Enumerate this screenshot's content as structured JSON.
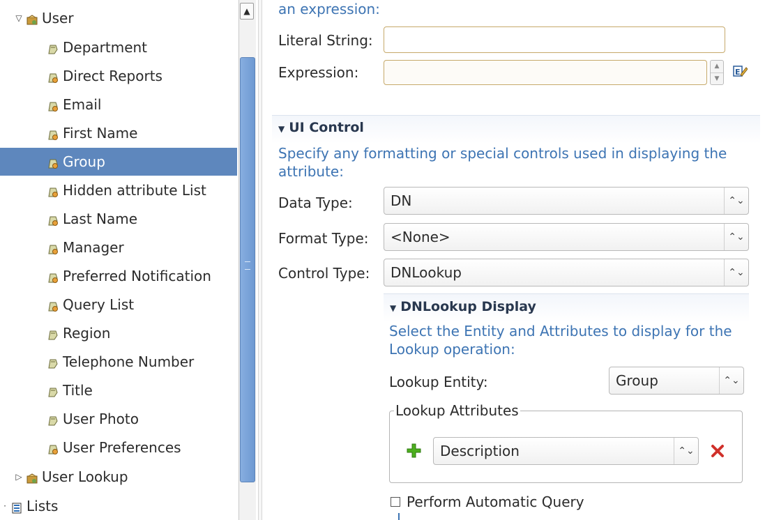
{
  "tree": {
    "root_label": "User",
    "children": [
      {
        "label": "Department",
        "icon": "attribute-icon"
      },
      {
        "label": "Direct Reports",
        "icon": "attribute-key-icon"
      },
      {
        "label": "Email",
        "icon": "attribute-key-icon"
      },
      {
        "label": "First Name",
        "icon": "attribute-key-icon"
      },
      {
        "label": "Group",
        "icon": "attribute-key-icon",
        "selected": true
      },
      {
        "label": "Hidden attribute List",
        "icon": "attribute-key-icon"
      },
      {
        "label": "Last Name",
        "icon": "attribute-key-icon"
      },
      {
        "label": "Manager",
        "icon": "attribute-key-icon"
      },
      {
        "label": "Preferred Notification",
        "icon": "attribute-key-icon"
      },
      {
        "label": "Query List",
        "icon": "attribute-key-icon"
      },
      {
        "label": "Region",
        "icon": "attribute-icon"
      },
      {
        "label": "Telephone Number",
        "icon": "attribute-icon"
      },
      {
        "label": "Title",
        "icon": "attribute-icon"
      },
      {
        "label": "User Photo",
        "icon": "attribute-icon"
      },
      {
        "label": "User Preferences",
        "icon": "attribute-key-icon"
      }
    ],
    "sibling_label": "User Lookup",
    "lists_label": "Lists"
  },
  "form": {
    "expression_hint": "an expression:",
    "literal_label": "Literal String:",
    "literal_value": "",
    "expression_label": "Expression:",
    "expression_value": "",
    "ui_section_title": "UI Control",
    "ui_section_desc": "Specify any formatting or special controls used in displaying the attribute:",
    "data_type_label": "Data Type:",
    "data_type_value": "DN",
    "format_type_label": "Format Type:",
    "format_type_value": "<None>",
    "control_type_label": "Control Type:",
    "control_type_value": "DNLookup",
    "dn_section_title": "DNLookup Display",
    "dn_section_desc": "Select the Entity and Attributes to display for the Lookup operation:",
    "lookup_entity_label": "Lookup Entity:",
    "lookup_entity_value": "Group",
    "lookup_attrs_legend": "Lookup Attributes",
    "lookup_attr_value": "Description",
    "auto_query_label": "Perform Automatic Query",
    "auto_query_checked": false
  },
  "colors": {
    "selection": "#5e87bd",
    "link_blue": "#3d74b3",
    "remove_red": "#d0302a",
    "add_green": "#4caf1e"
  }
}
